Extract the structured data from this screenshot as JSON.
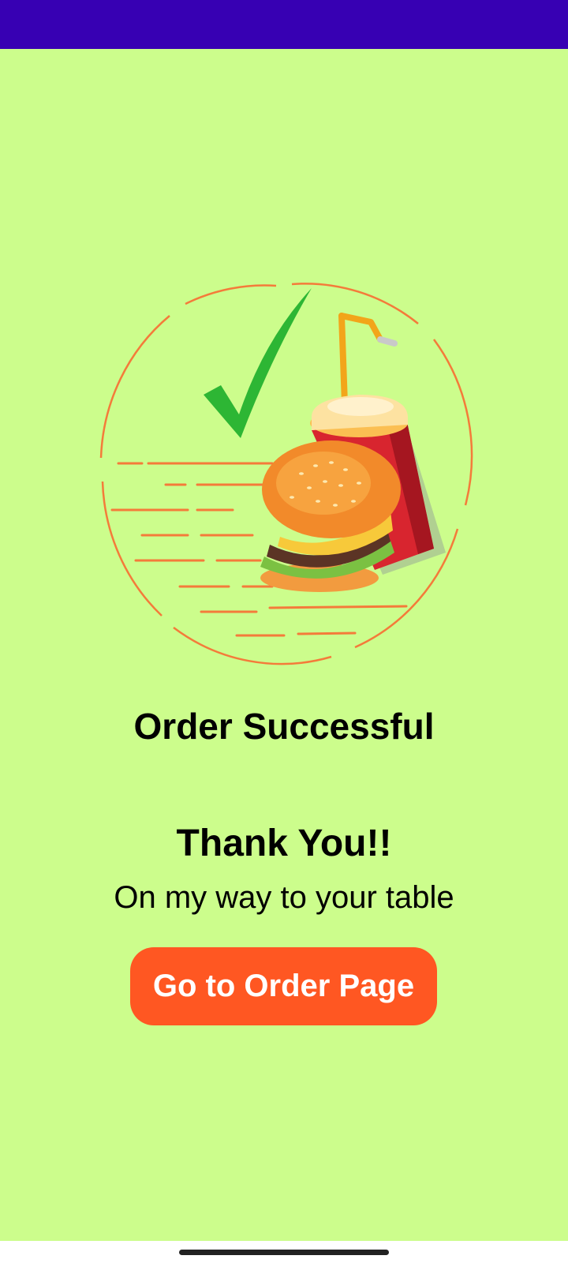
{
  "status_bar": {
    "color": "#3700b3"
  },
  "illustration": {
    "icon": "order-success-food-illustration",
    "check_color": "#2db634",
    "ring_color": "#f47b3a"
  },
  "title": "Order Successful",
  "thanks": "Thank You!!",
  "subtitle": "On my way to your table",
  "order_button": {
    "label": "Go to Order Page",
    "color": "#ff5722"
  },
  "theme": {
    "background": "#ccfd8c"
  }
}
